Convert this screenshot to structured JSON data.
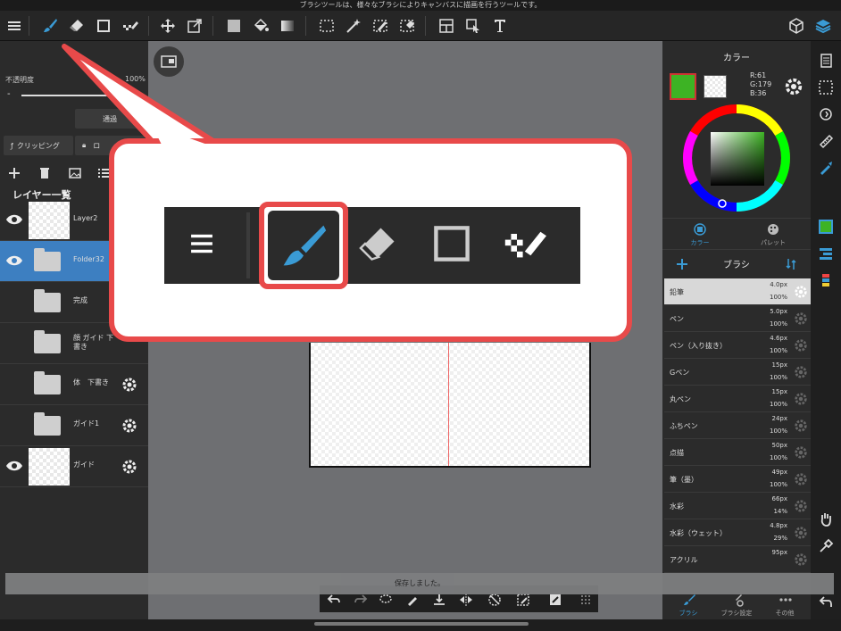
{
  "hint": "ブラシツールは、様々なブラシによりキャンバスに描画を行うツールです。",
  "left_panel": {
    "opacity_label": "不透明度",
    "opacity_value": "100%",
    "opacity_minus": "-",
    "blend_mode": "通過",
    "clipping": "クリッピング",
    "lock": "ロ",
    "layer_list_title": "レイヤー一覧",
    "layers": [
      {
        "name": "Layer2",
        "type": "raster",
        "visible": true
      },
      {
        "name": "Folder32",
        "type": "folder",
        "visible": true,
        "selected": true
      },
      {
        "name": "完成",
        "type": "folder"
      },
      {
        "name": "顔 ガイド 下書き",
        "type": "folder"
      },
      {
        "name": "体　下書き",
        "type": "folder"
      },
      {
        "name": "ガイド1",
        "type": "folder"
      },
      {
        "name": "ガイド",
        "type": "raster",
        "visible": true
      }
    ]
  },
  "right_panel": {
    "color_title": "カラー",
    "rgb": {
      "r": "R:61",
      "g": "G:179",
      "b": "B:36"
    },
    "main_color": "#3db324",
    "tabs": [
      "カラー",
      "パレット"
    ],
    "brush_title": "ブラシ",
    "brushes": [
      {
        "name": "鉛筆",
        "size": "4.0px",
        "opacity": "100%",
        "selected": true
      },
      {
        "name": "ペン",
        "size": "5.0px",
        "opacity": "100%"
      },
      {
        "name": "ペン（入り抜き）",
        "size": "4.6px",
        "opacity": "100%"
      },
      {
        "name": "Gペン",
        "size": "15px",
        "opacity": "100%"
      },
      {
        "name": "丸ペン",
        "size": "15px",
        "opacity": "100%"
      },
      {
        "name": "ふちペン",
        "size": "24px",
        "opacity": "100%"
      },
      {
        "name": "点描",
        "size": "50px",
        "opacity": "100%"
      },
      {
        "name": "筆（墨）",
        "size": "49px",
        "opacity": "100%"
      },
      {
        "name": "水彩",
        "size": "66px",
        "opacity": "14%"
      },
      {
        "name": "水彩（ウェット）",
        "size": "4.8px",
        "opacity": "29%"
      },
      {
        "name": "アクリル",
        "size": "95px",
        "opacity": ""
      }
    ],
    "bottom_tabs": [
      "ブラシ",
      "ブラシ設定",
      "その他"
    ]
  },
  "toast": "保存しました。",
  "accent": "#e84a4a",
  "selection_color": "#3d7fc1"
}
